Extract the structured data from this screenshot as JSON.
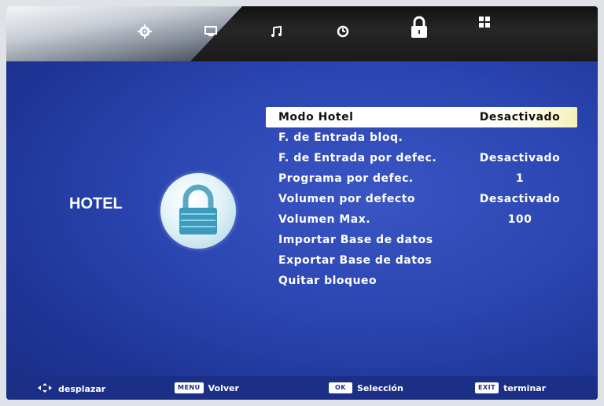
{
  "tabs": [
    {
      "icon": "gear-icon"
    },
    {
      "icon": "monitor-icon"
    },
    {
      "icon": "music-note-icon"
    },
    {
      "icon": "clock-icon"
    },
    {
      "icon": "lock-icon"
    },
    {
      "icon": "grid-icon"
    }
  ],
  "section": {
    "title": "HOTEL",
    "icon": "padlock-icon"
  },
  "menu": {
    "items": [
      {
        "label": "Modo Hotel",
        "value": "Desactivado",
        "selected": true
      },
      {
        "label": "F. de Entrada bloq.",
        "value": ""
      },
      {
        "label": "F. de Entrada por defec.",
        "value": "Desactivado"
      },
      {
        "label": "Programa por defec.",
        "value": "1"
      },
      {
        "label": "Volumen por defecto",
        "value": "Desactivado"
      },
      {
        "label": "Volumen Max.",
        "value": "100"
      },
      {
        "label": "Importar Base de datos",
        "value": ""
      },
      {
        "label": "Exportar Base de datos",
        "value": ""
      },
      {
        "label": "Quitar bloqueo",
        "value": ""
      }
    ]
  },
  "footer": {
    "move": {
      "icon": "arrows-icon",
      "label": "desplazar"
    },
    "back": {
      "key": "MENU",
      "label": "Volver"
    },
    "select": {
      "key": "OK",
      "label": "Selección"
    },
    "exit": {
      "key": "EXIT",
      "label": "terminar"
    }
  },
  "colors": {
    "accent": "#2a44b0",
    "highlight": "#ffffff"
  }
}
